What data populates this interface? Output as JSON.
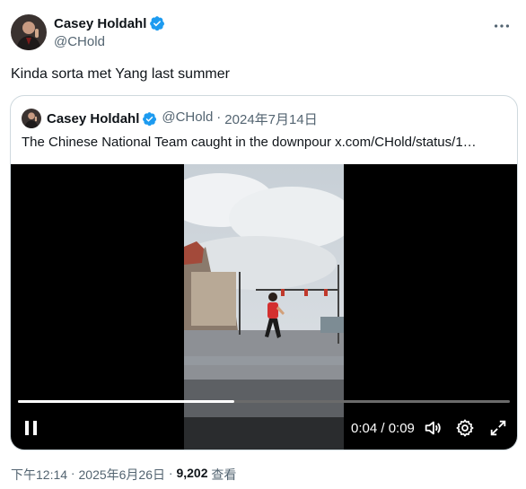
{
  "author": {
    "name": "Casey Holdahl",
    "handle": "@CHold"
  },
  "tweet": {
    "text": "Kinda sorta met Yang last summer"
  },
  "quoted": {
    "name": "Casey Holdahl",
    "handle": "@CHold",
    "separator": "·",
    "date": "2024年7月14日",
    "text": "The Chinese National Team caught in the downpour  x.com/CHold/status/1…"
  },
  "video": {
    "progress_fraction": 0.44,
    "time": "0:04 / 0:09"
  },
  "footer": {
    "time": "下午12:14",
    "sep1": " · ",
    "date": "2025年6月26日",
    "sep2": " · ",
    "views": "9,202",
    "views_label": " 查看"
  },
  "colors": {
    "verified": "#1d9bf0",
    "secondary_text": "#536471",
    "border": "#cfd9de"
  }
}
